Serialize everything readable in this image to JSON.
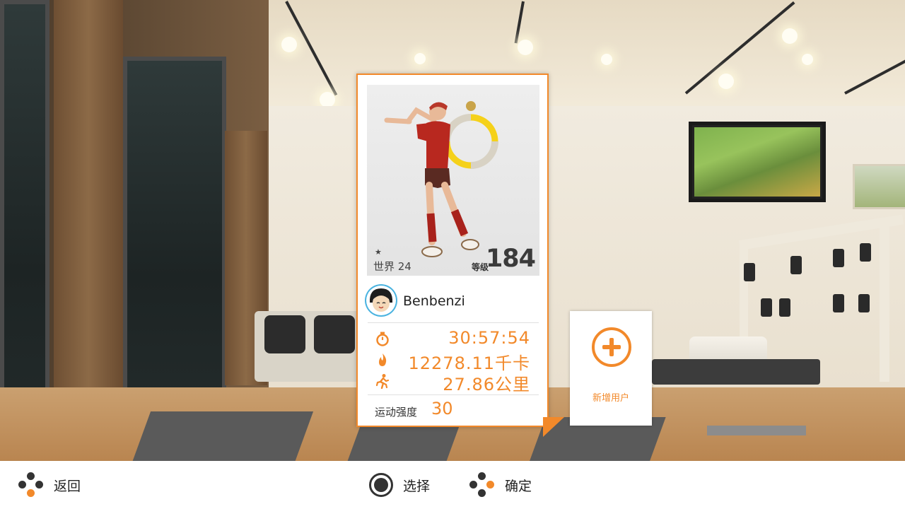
{
  "player": {
    "world_label": "世界 24",
    "level_label": "等级",
    "level_value": "184",
    "username": "Benbenzi"
  },
  "stats": {
    "time": "30:57:54",
    "calories": "12278.11千卡",
    "distance": "27.86公里",
    "intensity_label": "运动强度",
    "intensity_value": "30"
  },
  "add_user": {
    "label": "新增用户"
  },
  "controls": {
    "back_label": "返回",
    "select_label": "选择",
    "confirm_label": "确定"
  },
  "colors": {
    "accent": "#f2892a"
  },
  "icons": {
    "time": "stopwatch-icon",
    "calories": "flame-icon",
    "distance": "running-icon",
    "add": "plus-circle-icon"
  }
}
